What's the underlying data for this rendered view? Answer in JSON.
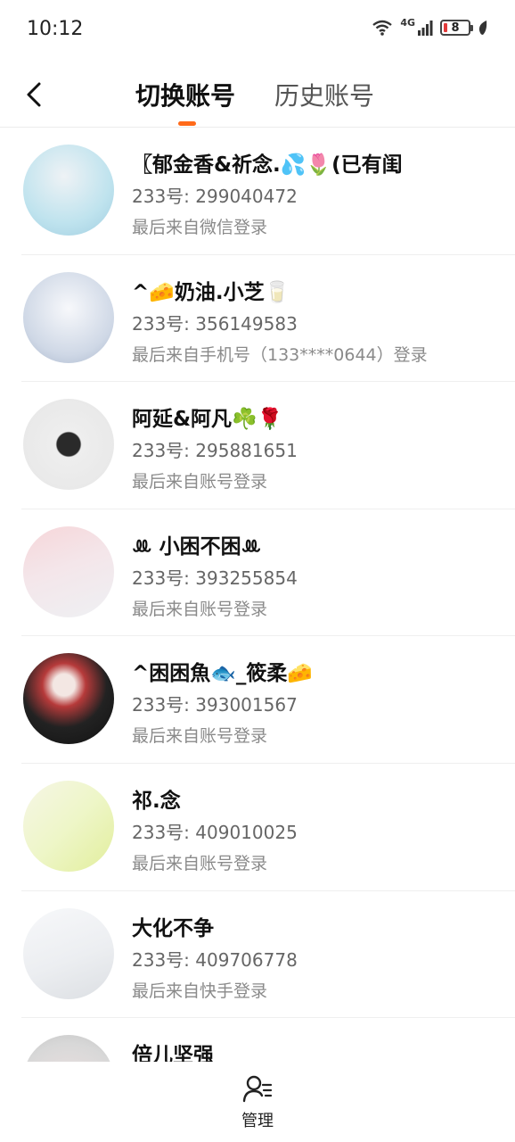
{
  "status_bar": {
    "time": "10:12",
    "network": "4G",
    "battery_level": "8"
  },
  "header": {
    "back_icon": "chevron-left-icon",
    "tabs": [
      {
        "label": "切换账号",
        "active": true
      },
      {
        "label": "历史账号",
        "active": false
      }
    ],
    "accent_color": "#ff6a1a"
  },
  "accounts": [
    {
      "name": "〖郁金香&祈念.💦🌷(已有闺",
      "uid": "233号: 299040472",
      "login": "最后来自微信登录",
      "avatar_colors": [
        "#bfe3ee",
        "#eef2f5"
      ]
    },
    {
      "name": "^🧀奶油.小芝🥛",
      "uid": "233号: 356149583",
      "login": "最后来自手机号（133****0644）登录",
      "avatar_colors": [
        "#cfd8e6",
        "#f3f4f7"
      ]
    },
    {
      "name": "阿延&阿凡☘️🌹",
      "uid": "233号: 295881651",
      "login": "最后来自账号登录",
      "avatar_colors": [
        "#eeeeee",
        "#d9d9d9"
      ]
    },
    {
      "name": "ꔛ 小困不困ꔛ",
      "uid": "233号: 393255854",
      "login": "最后来自账号登录",
      "avatar_colors": [
        "#f6d6d9",
        "#eef0f3"
      ]
    },
    {
      "name": "^困困魚🐟_筱柔🧀",
      "uid": "233号: 393001567",
      "login": "最后来自账号登录",
      "avatar_colors": [
        "#222222",
        "#b63a3a"
      ]
    },
    {
      "name": "祁.念",
      "uid": "233号: 409010025",
      "login": "最后来自账号登录",
      "avatar_colors": [
        "#eef6c8",
        "#f6f6e6"
      ]
    },
    {
      "name": "大化不争",
      "uid": "233号: 409706778",
      "login": "最后来自快手登录",
      "avatar_colors": [
        "#f2f3f5",
        "#e3e5e8"
      ]
    },
    {
      "name": "倍儿坚强",
      "uid": "",
      "login": "",
      "avatar_colors": [
        "#d8d8d8",
        "#f1e2e2"
      ]
    }
  ],
  "bottom_bar": {
    "manage_icon": "user-list-icon",
    "manage_label": "管理"
  }
}
